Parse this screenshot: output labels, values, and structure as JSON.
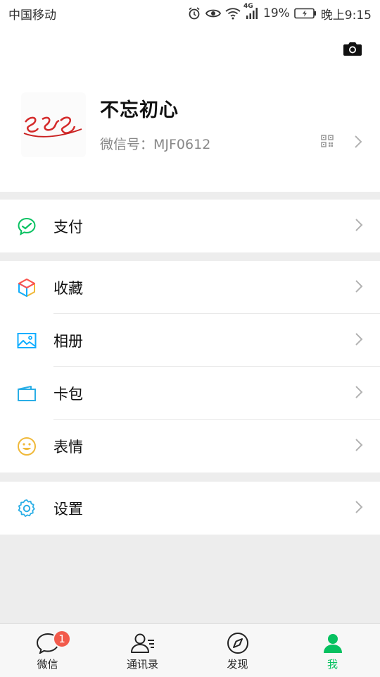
{
  "status_bar": {
    "carrier": "中国移动",
    "network": "4G",
    "battery": "19%",
    "time": "晚上9:15"
  },
  "profile": {
    "nickname": "不忘初心",
    "wechat_id_label": "微信号：MJF0612",
    "avatar_text": "SZS"
  },
  "menu": {
    "pay": {
      "label": "支付",
      "icon": "pay-icon"
    },
    "favorites": {
      "label": "收藏",
      "icon": "favorites-cube-icon"
    },
    "album": {
      "label": "相册",
      "icon": "album-image-icon"
    },
    "cards": {
      "label": "卡包",
      "icon": "card-wallet-icon"
    },
    "stickers": {
      "label": "表情",
      "icon": "smiley-icon"
    },
    "settings": {
      "label": "设置",
      "icon": "gear-icon"
    }
  },
  "bottom_nav": {
    "chats": {
      "label": "微信",
      "badge": "1"
    },
    "contacts": {
      "label": "通讯录"
    },
    "discover": {
      "label": "发现"
    },
    "me": {
      "label": "我"
    }
  },
  "colors": {
    "accent_green": "#07c160",
    "badge_red": "#f25a4b",
    "text_primary": "#111111",
    "text_secondary": "#888888",
    "background": "#ededed"
  }
}
